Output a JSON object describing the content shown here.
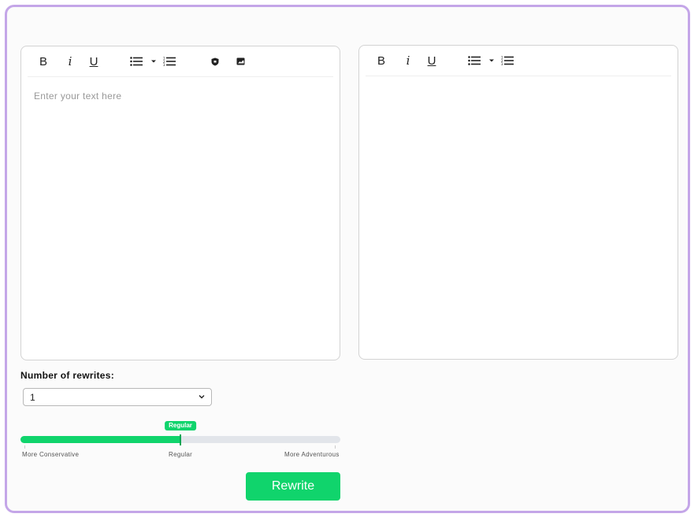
{
  "left_editor": {
    "toolbar": {
      "bold": "B",
      "italic": "i",
      "underline": "U"
    },
    "placeholder": "Enter your text here"
  },
  "right_editor": {
    "toolbar": {
      "bold": "B",
      "italic": "i",
      "underline": "U"
    }
  },
  "rewrites": {
    "label": "Number of rewrites:",
    "selected": "1"
  },
  "creativity": {
    "value_label": "Regular",
    "level": 0.5,
    "min_label": "More Conservative",
    "mid_label": "Regular",
    "max_label": "More Adventurous"
  },
  "rewrite_button": "Rewrite",
  "colors": {
    "accent": "#10d46c",
    "frame": "#c4a6e8"
  },
  "icons": {
    "bullet_list": "bulleted-list-icon",
    "dropdown": "caret-down-icon",
    "numbered_list": "numbered-list-icon",
    "shield": "shield-icon",
    "image": "image-icon"
  }
}
